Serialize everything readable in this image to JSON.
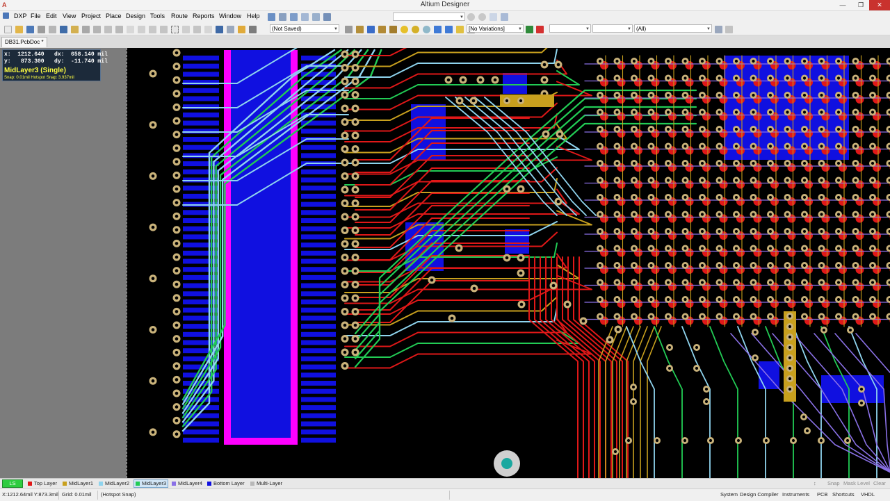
{
  "window": {
    "title": "Altium Designer",
    "controls": {
      "minimize": "—",
      "maximize": "❐",
      "close": "✕"
    }
  },
  "menu": {
    "items": [
      "DXP",
      "File",
      "Edit",
      "View",
      "Project",
      "Place",
      "Design",
      "Tools",
      "Route",
      "Reports",
      "Window",
      "Help"
    ]
  },
  "toolbar": {
    "save_state": "(Not Saved)",
    "variations": "[No Variations]",
    "filter": "(All)"
  },
  "document_tab": {
    "label": "DB31.PcbDoc *"
  },
  "hud": {
    "line1": "x:  1212.640   dx:  658.140 mil",
    "line2": "y:   873.300   dy:  -11.740 mil",
    "layer": "MidLayer3 (Single)",
    "snap": "Snap: 0.01mil Hotspot Snap: 3.937mil"
  },
  "layers": [
    {
      "name": "LS",
      "color": "#2ecc40"
    },
    {
      "name": "Top Layer",
      "color": "#e01818"
    },
    {
      "name": "MidLayer1",
      "color": "#c8a01e"
    },
    {
      "name": "MidLayer2",
      "color": "#8fd4ee"
    },
    {
      "name": "MidLayer3",
      "color": "#22cc55"
    },
    {
      "name": "MidLayer4",
      "color": "#8a70e6"
    },
    {
      "name": "Bottom Layer",
      "color": "#1010e0"
    },
    {
      "name": "Multi-Layer",
      "color": "#b8b8b8"
    }
  ],
  "layer_bar_right": {
    "snap": "Snap",
    "mask_level": "Mask Level",
    "clear": "Clear"
  },
  "status": {
    "coords": "X:1212.64mil Y:873.3mil",
    "grid": "Grid: 0.01mil",
    "hotspot": "(Hotspot Snap)",
    "panels": [
      "System",
      "Design Compiler",
      "Instruments",
      "PCB",
      "Shortcuts",
      "VHDL"
    ]
  },
  "colors": {
    "top_layer": "#e01818",
    "mid1": "#c8a01e",
    "mid2": "#8fd4ee",
    "mid3": "#22cc55",
    "mid4": "#8a70e6",
    "bottom": "#1010e0",
    "magenta": "#ff00ff",
    "pad": "#c9b27a",
    "selected_via": "#1aa8a0"
  }
}
